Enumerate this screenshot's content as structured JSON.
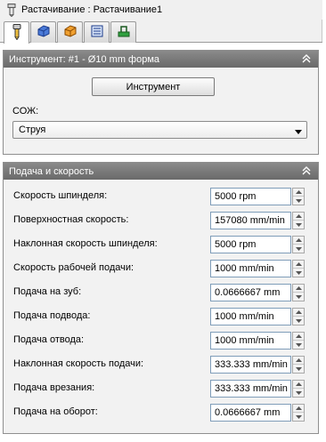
{
  "window": {
    "title": "Растачивание : Растачивание1"
  },
  "tabs": [
    {
      "icon": "tool-icon",
      "active": true
    },
    {
      "icon": "geometry-icon",
      "active": false
    },
    {
      "icon": "heights-icon",
      "active": false
    },
    {
      "icon": "passes-icon",
      "active": false
    },
    {
      "icon": "linking-icon",
      "active": false
    }
  ],
  "tool_group": {
    "title": "Инструмент: #1 - Ø10 mm форма",
    "tool_button_label": "Инструмент",
    "coolant_label": "СОЖ:",
    "coolant_value": "Струя"
  },
  "feed_group": {
    "title": "Подача и скорость",
    "rows": [
      {
        "label": "Скорость шпинделя:",
        "value": "5000 rpm"
      },
      {
        "label": "Поверхностная скорость:",
        "value": "157080 mm/min"
      },
      {
        "label": "Наклонная скорость шпинделя:",
        "value": "5000 rpm"
      },
      {
        "label": "Скорость рабочей подачи:",
        "value": "1000 mm/min"
      },
      {
        "label": "Подача на зуб:",
        "value": "0.0666667 mm"
      },
      {
        "label": "Подача подвода:",
        "value": "1000 mm/min"
      },
      {
        "label": "Подача отвода:",
        "value": "1000 mm/min"
      },
      {
        "label": "Наклонная скорость подачи:",
        "value": "333.333 mm/min"
      },
      {
        "label": "Подача врезания:",
        "value": "333.333 mm/min"
      },
      {
        "label": "Подача на оборот:",
        "value": "0.0666667 mm"
      }
    ]
  }
}
